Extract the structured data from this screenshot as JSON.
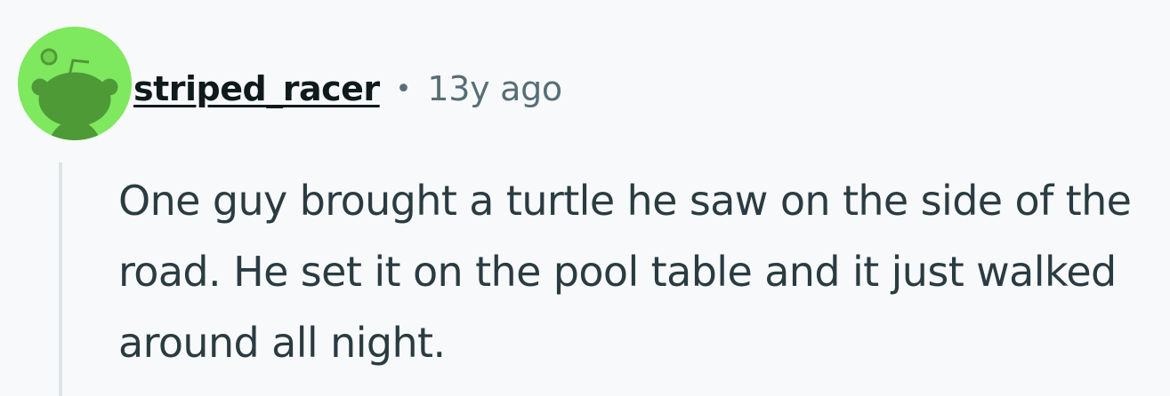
{
  "comment": {
    "author": "striped_racer",
    "separator": "•",
    "age": "13y ago",
    "body": "One guy brought a turtle he saw on the side of the road. He set it on the pool table and it just walked around all night.",
    "avatar": {
      "icon": "snoo-avatar-icon",
      "background_color": "#7ee85e",
      "figure_color": "#4e9a37"
    }
  }
}
